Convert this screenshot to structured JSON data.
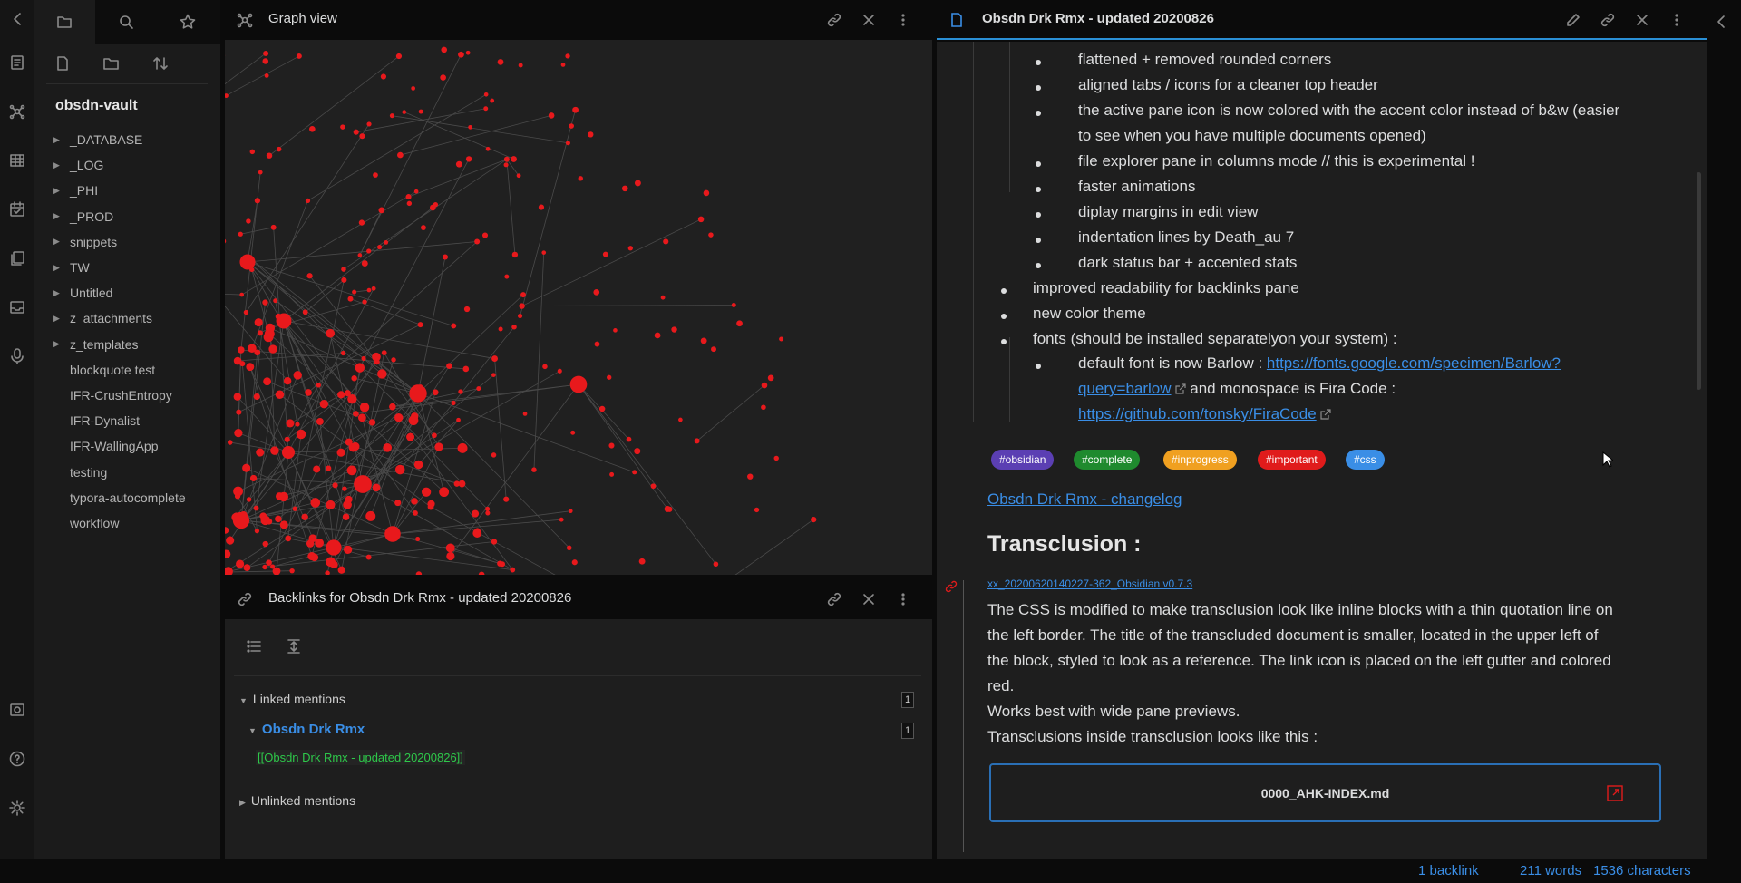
{
  "sidebar": {
    "vault_name": "obsdn-vault",
    "folders": [
      "_DATABASE",
      "_LOG",
      "_PHI",
      "_PROD",
      "snippets",
      "TW",
      "Untitled",
      "z_attachments",
      "z_templates"
    ],
    "files": [
      "blockquote test",
      "IFR-CrushEntropy",
      "IFR-Dynalist",
      "IFR-WallingApp",
      "testing",
      "typora-autocomplete",
      "workflow"
    ]
  },
  "graph_pane": {
    "title": "Graph view"
  },
  "backlinks_pane": {
    "title": "Backlinks for Obsdn Drk Rmx - updated 20200826",
    "linked_label": "Linked mentions",
    "linked_count": "1",
    "doc_name": "Obsdn Drk Rmx",
    "doc_count": "1",
    "mention": "[[Obsdn Drk Rmx - updated 20200826]]",
    "unlinked_label": "Unlinked mentions"
  },
  "doc_pane": {
    "title": "Obsdn Drk Rmx - updated 20200826",
    "sub_bullets_1": [
      "flattened + removed rounded corners",
      "aligned tabs / icons for a cleaner top header",
      "the active pane icon is now colored with the accent color instead of b&w (easier",
      "to see when you have multiple documents opened)",
      "file explorer pane in columns mode // this is experimental !",
      "faster animations",
      "diplay margins in edit view",
      "indentation lines by Death_au 7",
      "dark status bar + accented stats"
    ],
    "bullets": [
      "improved readability for backlinks pane",
      "new color theme",
      "fonts (should be installed separatelyon your system) :"
    ],
    "font_line_prefix": "default font is now Barlow : ",
    "font_link_1a": "https://fonts.google.com/specimen/Barlow?",
    "font_link_1b": "query=barlow",
    "font_line_mid": " and monospace is Fira Code :",
    "font_link_2": "https://github.com/tonsky/FiraCode",
    "tags": [
      {
        "label": "#obsidian",
        "color": "#5b3fb3"
      },
      {
        "label": "#complete",
        "color": "#1f8a2e"
      },
      {
        "label": "#inprogress",
        "color": "#f0a020"
      },
      {
        "label": "#important",
        "color": "#e01b1b"
      },
      {
        "label": "#css",
        "color": "#3a8ee6"
      }
    ],
    "changelog_link": "Obsdn Drk Rmx - changelog",
    "heading": "Transclusion :",
    "transclusion_source": "xx_20200620140227-362_Obsidian v0.7.3",
    "paragraph": [
      "The CSS is modified to make transclusion look like inline blocks with a thin quotation line on",
      "the left border. The title of the transcluded document is smaller, located in the upper left of",
      "the block, styled to look as a reference. The link icon is placed on the left gutter and colored",
      "red.",
      "Works best with wide pane previews.",
      "Transclusions inside transclusion looks like this :"
    ],
    "embed_title": "0000_AHK-INDEX.md"
  },
  "status_bar": {
    "backlinks": "1 backlink",
    "words": "211 words",
    "chars": "1536 characters"
  },
  "colors": {
    "accent": "#3a8ee6",
    "graph_node": "#e8191c"
  }
}
